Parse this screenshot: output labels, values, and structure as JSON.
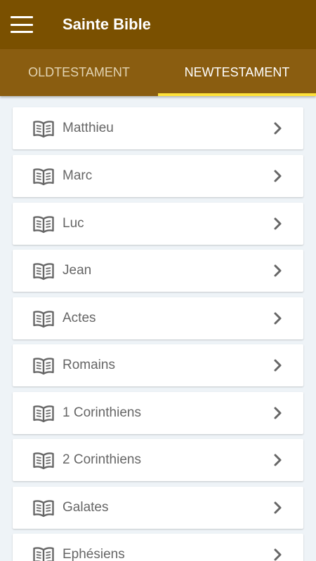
{
  "app": {
    "title": "Sainte Bible"
  },
  "colors": {
    "appbar": "#7a5000",
    "tabbar": "#8a5d10",
    "indicator": "#ffe23a"
  },
  "tabs": [
    {
      "label": "OLDTESTAMENT",
      "active": false
    },
    {
      "label": "NEWTESTAMENT",
      "active": true
    }
  ],
  "books": [
    {
      "label": "Matthieu"
    },
    {
      "label": "Marc"
    },
    {
      "label": "Luc"
    },
    {
      "label": "Jean"
    },
    {
      "label": "Actes"
    },
    {
      "label": "Romains"
    },
    {
      "label": "1 Corinthiens"
    },
    {
      "label": "2 Corinthiens"
    },
    {
      "label": "Galates"
    },
    {
      "label": "Ephésiens"
    }
  ],
  "icons": {
    "item": "open-book-icon",
    "trailing": "chevron-right-icon",
    "menu": "hamburger-menu-icon"
  }
}
